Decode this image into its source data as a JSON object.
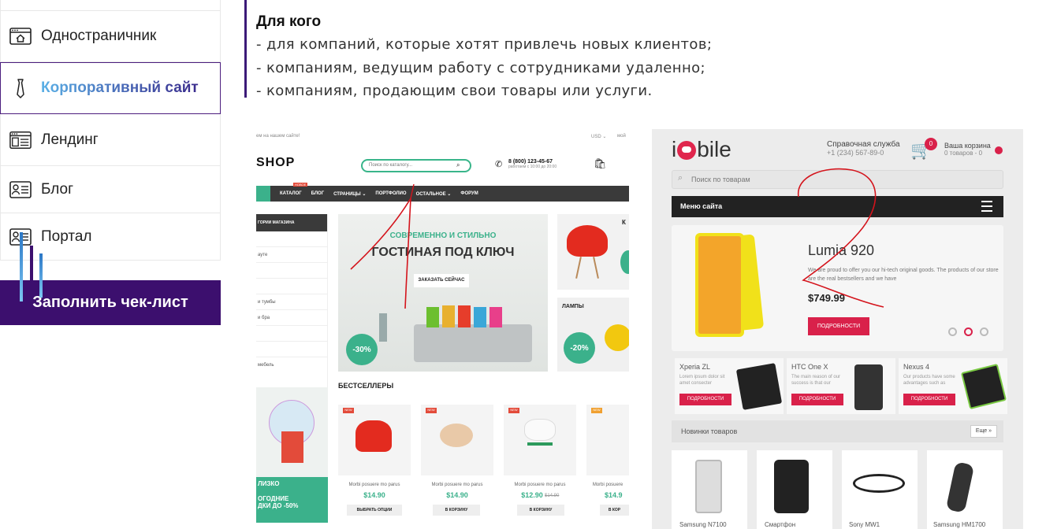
{
  "sidebar": {
    "items": [
      {
        "label": "Одностраничник",
        "icon": "browser-home-icon"
      },
      {
        "label": "Корпоративный сайт",
        "icon": "tie-icon",
        "active": true
      },
      {
        "label": "Лендинг",
        "icon": "browser-layout-icon"
      },
      {
        "label": "Блог",
        "icon": "id-card-icon"
      },
      {
        "label": "Портал",
        "icon": "id-card-icon"
      }
    ],
    "cta_label": "Заполнить чек-лист"
  },
  "content": {
    "heading": "Для кого",
    "lines": [
      "- для компаний, которые хотят привлечь новых клиентов;",
      "- компаниям, ведущим работу с сотрудниками удаленно;",
      "- компаниям, продающим свои товары или услуги."
    ]
  },
  "example1": {
    "top_left": "ем на нашем сайте!",
    "top_right_1": "USD ⌄",
    "top_right_2": "мой",
    "logo": "SHOP",
    "search_placeholder": "Поиск по каталогу...",
    "phone": "8 (800) 123-45-67",
    "hours": "работаем с 10:00 до 20:00",
    "nav": [
      "КАТАЛОГ",
      "БЛОГ",
      "СТРАНИЦЫ ⌄",
      "ПОРТФОЛИО",
      "ОСТАЛЬНОЕ ⌄",
      "ФОРУМ"
    ],
    "nav_badge": "НОВОЕ",
    "side_head": "ГОРИИ МАГАЗИНА",
    "side_rows": [
      "",
      "ауте",
      "",
      "",
      "и тумбы",
      "и бра",
      "",
      "",
      "мебель"
    ],
    "hero_sub": "СОВРЕМЕННО И СТИЛЬНО",
    "hero_title": "ГОСТИНАЯ ПОД КЛЮЧ",
    "hero_btn": "ЗАКАЗАТЬ СЕЙЧАС",
    "hero_badge": "-30%",
    "right_badge": "-20%",
    "lamps": "ЛАМПЫ",
    "bestsellers": "БЕСТСЕЛЛЕРЫ",
    "products": [
      {
        "name": "Morbi posuere mo parus",
        "price": "$14.90",
        "old": "",
        "btn": "ВЫБРАТЬ ОПЦИИ"
      },
      {
        "name": "Morbi posuere mo parus",
        "price": "$14.90",
        "old": "",
        "btn": "В КОРЗИНУ"
      },
      {
        "name": "Morbi posuere mo parus",
        "price": "$12.90",
        "old": "$14.90",
        "btn": "В КОРЗИНУ"
      },
      {
        "name": "Morbi posuere",
        "price": "$14.9",
        "old": "",
        "btn": "В КОР"
      }
    ],
    "new_label": "NEW",
    "promo_1": "ЛИЗКО",
    "promo_2": "ОГОДНИЕ",
    "promo_3": "ДКИ ДО -50%"
  },
  "example2": {
    "logo_pre": "i",
    "logo_post": "bile",
    "help_title": "Справочная служба",
    "help_phone": "+1 (234) 567-89-0",
    "cart_count": "0",
    "cart_title": "Ваша корзина",
    "cart_sub": "0 товаров - 0",
    "search_placeholder": "Поиск по товарам",
    "menu": "Меню сайта",
    "hero_title": "Lumia 920",
    "hero_desc": "We are proud to offer you our hi-tech original goods. The products of our store are the real bestsellers and we have",
    "hero_price": "$749.99",
    "hero_btn": "ПОДРОБНОСТИ",
    "cards": [
      {
        "name": "Xperia ZL",
        "desc": "Lorem ipsum dolor sit amet consecter",
        "btn": "ПОДРОБНОСТИ"
      },
      {
        "name": "HTC One X",
        "desc": "The main reason of our success is that our",
        "btn": "ПОДРОБНОСТИ"
      },
      {
        "name": "Nexus 4",
        "desc": "Our products have some advantages such as",
        "btn": "ПОДРОБНОСТИ"
      }
    ],
    "new_products": "Новинки товаров",
    "more": "Еще »",
    "tiles": [
      "Samsung N7100",
      "Смартфон",
      "Sony MW1",
      "Samsung HM1700"
    ]
  },
  "colors": {
    "accent": "#3c0f6e",
    "green": "#3bb18b",
    "red": "#d9214a",
    "annotation": "#d4141c"
  }
}
